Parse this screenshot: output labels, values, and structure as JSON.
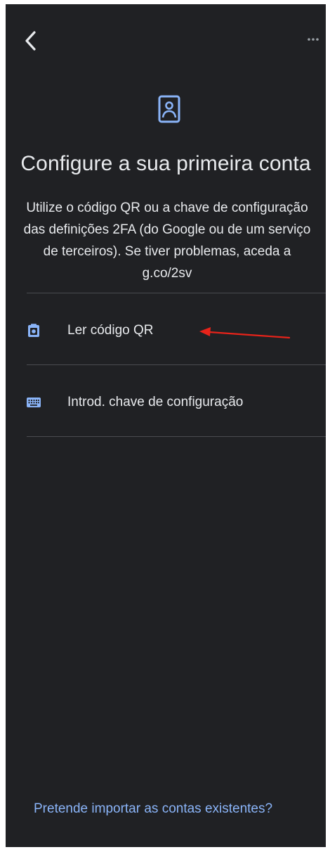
{
  "header": {
    "back_icon": "chevron-left-icon",
    "more_icon": "more-horizontal-icon",
    "account_icon": "account-box-icon"
  },
  "main": {
    "title": "Configure a sua primeira conta",
    "subtitle": "Utilize o código QR ou a chave de configuração das definições 2FA (do Google ou de um serviço de terceiros). Se tiver problemas, aceda a g.co/2sv"
  },
  "options": [
    {
      "label": "Ler código QR",
      "icon": "qr-camera-icon"
    },
    {
      "label": "Introd. chave de configuração",
      "icon": "keyboard-icon"
    }
  ],
  "footer": {
    "import_link": "Pretende importar as contas existentes?"
  },
  "colors": {
    "background": "#202124",
    "text": "#e8eaed",
    "accent": "#8ab4f8",
    "annotation": "#e8231a"
  }
}
